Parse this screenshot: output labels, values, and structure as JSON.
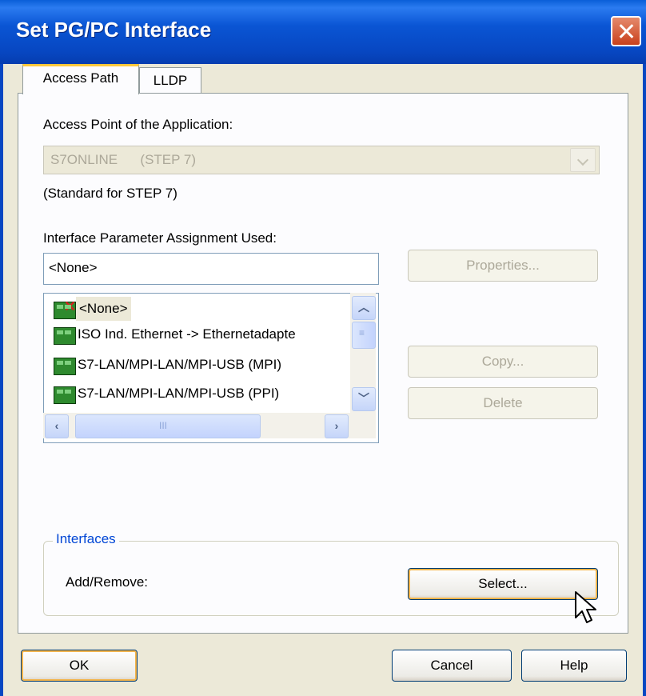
{
  "window": {
    "title": "Set PG/PC Interface"
  },
  "tabs": [
    {
      "label": "Access Path",
      "active": true
    },
    {
      "label": "LLDP",
      "active": false
    }
  ],
  "access_point": {
    "label": "Access Point of the Application:",
    "value": "S7ONLINE      (STEP 7)",
    "enabled": false,
    "note": "(Standard for STEP 7)"
  },
  "parameter_assignment": {
    "label": "Interface Parameter Assignment Used:",
    "value": "<None>",
    "items": [
      {
        "label": "<None>",
        "selected": true,
        "icon": "interface-disabled-icon"
      },
      {
        "label": "ISO Ind. Ethernet -> Ethernetadapte",
        "selected": false,
        "icon": "interface-card-icon"
      },
      {
        "label": "S7-LAN/MPI-LAN/MPI-USB (MPI)",
        "selected": false,
        "icon": "interface-card-icon"
      },
      {
        "label": "S7-LAN/MPI-LAN/MPI-USB (PPI)",
        "selected": false,
        "icon": "interface-card-icon"
      }
    ]
  },
  "side_buttons": {
    "properties": "Properties...",
    "copy": "Copy...",
    "delete": "Delete"
  },
  "interfaces": {
    "title": "Interfaces",
    "add_remove_label": "Add/Remove:",
    "select_button": "Select..."
  },
  "footer": {
    "ok": "OK",
    "cancel": "Cancel",
    "help": "Help"
  },
  "colors": {
    "titlebar": "#0a55d4",
    "dialog_bg": "#ece9d8",
    "tab_highlight": "#ffc83c",
    "group_title": "#0046d5"
  }
}
